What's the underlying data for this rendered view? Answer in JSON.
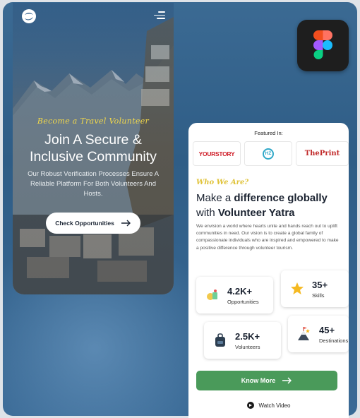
{
  "phone_left": {
    "script_heading": "Become a Travel Volunteer",
    "title_line1": "Join A Secure &",
    "title_line2": "Inclusive Community",
    "subtitle": "Our Robust Verification Processes Ensure A Reliable Platform For Both Volunteers And Hosts.",
    "cta_label": "Check Opportunities"
  },
  "phone_right": {
    "featured_label": "Featured In:",
    "press": [
      {
        "name": "YOURSTORY"
      },
      {
        "name": "HZ"
      },
      {
        "name": "ThePrint"
      }
    ],
    "script_heading": "Who We Are?",
    "heading_part1": "Make a ",
    "heading_bold1": "difference globally",
    "heading_part2": "with ",
    "heading_bold2": "Volunteer Yatra",
    "paragraph": "We envision a world where hearts unite and hands reach out to uplift communities in need. Our vision is to create a global family of compassionate individuals who are inspired and empowered to make a positive difference through volunteer tourism.",
    "stats": [
      {
        "value": "4.2K+",
        "label": "Opportunities",
        "icon": "opportunities-icon"
      },
      {
        "value": "35+",
        "label": "Skills",
        "icon": "star-icon"
      },
      {
        "value": "2.5K+",
        "label": "Volunteers",
        "icon": "backpack-icon"
      },
      {
        "value": "45+",
        "label": "Destinations",
        "icon": "mountain-flag-icon"
      }
    ],
    "know_more_label": "Know More",
    "watch_video_label": "Watch Video"
  },
  "colors": {
    "accent_green": "#4a9a5a",
    "script_yellow": "#f2d84a",
    "backdrop_blue": "#2f5d86"
  },
  "app_icon": "figma-icon"
}
